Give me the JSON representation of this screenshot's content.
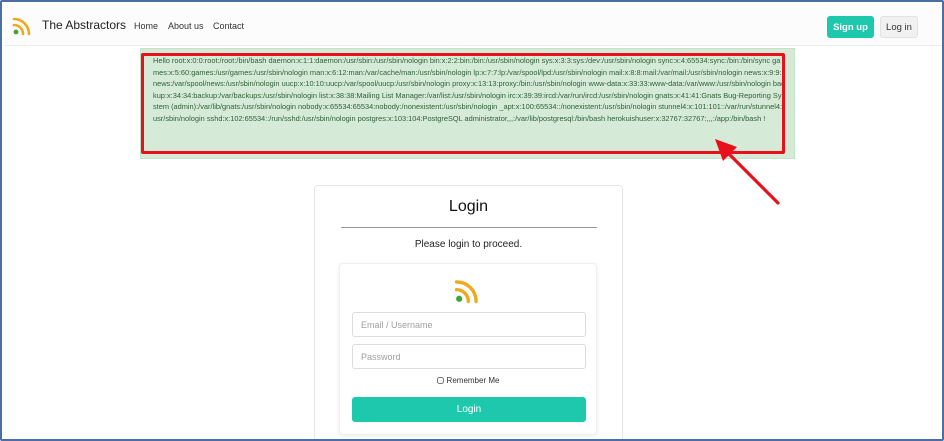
{
  "nav": {
    "brand": "The Abstractors",
    "links": [
      "Home",
      "About us",
      "Contact"
    ],
    "signup_label": "Sign up",
    "login_label": "Log in"
  },
  "alert": {
    "text": "Hello root:x:0:0:root:/root:/bin/bash daemon:x:1:1:daemon:/usr/sbin:/usr/sbin/nologin bin:x:2:2:bin:/bin:/usr/sbin/nologin sys:x:3:3:sys:/dev:/usr/sbin/nologin sync:x:4:65534:sync:/bin:/bin/sync games:x:5:60:games:/usr/games:/usr/sbin/nologin man:x:6:12:man:/var/cache/man:/usr/sbin/nologin lp:x:7:7:lp:/var/spool/lpd:/usr/sbin/nologin mail:x:8:8:mail:/var/mail:/usr/sbin/nologin news:x:9:9:news:/var/spool/news:/usr/sbin/nologin uucp:x:10:10:uucp:/var/spool/uucp:/usr/sbin/nologin proxy:x:13:13:proxy:/bin:/usr/sbin/nologin www-data:x:33:33:www-data:/var/www:/usr/sbin/nologin backup:x:34:34:backup:/var/backups:/usr/sbin/nologin list:x:38:38:Mailing List Manager:/var/list:/usr/sbin/nologin irc:x:39:39:ircd:/var/run/ircd:/usr/sbin/nologin gnats:x:41:41:Gnats Bug-Reporting System (admin):/var/lib/gnats:/usr/sbin/nologin nobody:x:65534:65534:nobody:/nonexistent:/usr/sbin/nologin _apt:x:100:65534::/nonexistent:/usr/sbin/nologin stunnel4:x:101:101::/var/run/stunnel4:/usr/sbin/nologin sshd:x:102:65534::/run/sshd:/usr/sbin/nologin postgres:x:103:104:PostgreSQL administrator,,,:/var/lib/postgresql:/bin/bash herokuishuser:x:32767:32767:,,,:/app:/bin/bash !"
  },
  "login": {
    "title": "Login",
    "subtitle": "Please login to proceed.",
    "email_placeholder": "Email / Username",
    "password_placeholder": "Password",
    "remember_label": "Remember Me",
    "submit_label": "Login"
  },
  "icons": {
    "brand": "rss-feed-icon",
    "form": "rss-feed-icon"
  },
  "colors": {
    "accent": "#1ec8ad",
    "alert_bg": "#d5ebd8",
    "alert_text": "#2f5f35",
    "annotation": "#e8101a",
    "frame": "#4a6fa5"
  }
}
